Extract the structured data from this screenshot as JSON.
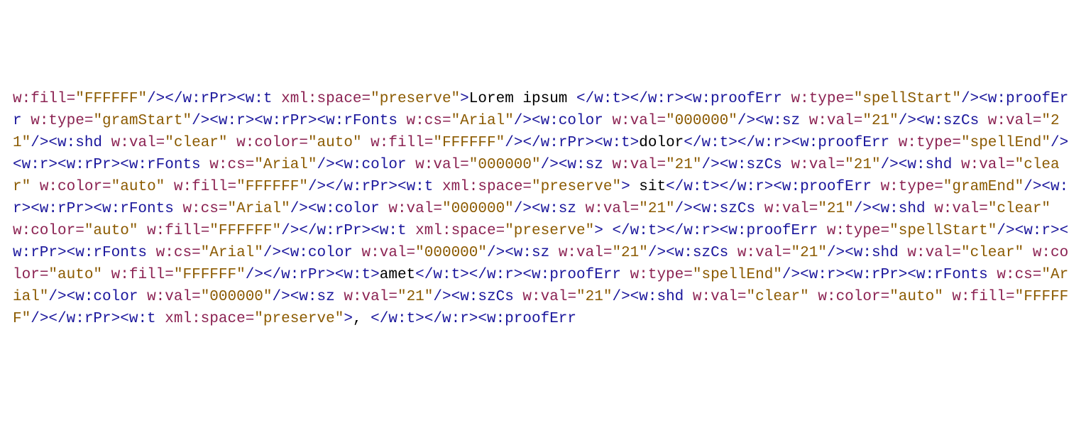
{
  "tokens": [
    {
      "t": "attrname",
      "v": "w:fill"
    },
    {
      "t": "punct",
      "v": "="
    },
    {
      "t": "attrval",
      "v": "\"FFFFFF\""
    },
    {
      "t": "tag",
      "v": "/></w:rPr><w:t"
    },
    {
      "t": "txt",
      "v": " "
    },
    {
      "t": "attrname",
      "v": "xml:space"
    },
    {
      "t": "punct",
      "v": "="
    },
    {
      "t": "attrval",
      "v": "\"preserve\""
    },
    {
      "t": "tag",
      "v": ">"
    },
    {
      "t": "txt",
      "v": "Lorem ipsum "
    },
    {
      "t": "tag",
      "v": "</w:t></w:r><w:proofErr"
    },
    {
      "t": "txt",
      "v": " "
    },
    {
      "t": "attrname",
      "v": "w:type"
    },
    {
      "t": "punct",
      "v": "="
    },
    {
      "t": "attrval",
      "v": "\"spellStart\""
    },
    {
      "t": "tag",
      "v": "/><w:proofErr"
    },
    {
      "t": "txt",
      "v": " "
    },
    {
      "t": "attrname",
      "v": "w:type"
    },
    {
      "t": "punct",
      "v": "="
    },
    {
      "t": "attrval",
      "v": "\"gramStart\""
    },
    {
      "t": "tag",
      "v": "/><w:r><w:rPr><w:rFonts"
    },
    {
      "t": "txt",
      "v": " "
    },
    {
      "t": "attrname",
      "v": "w:cs"
    },
    {
      "t": "punct",
      "v": "="
    },
    {
      "t": "attrval",
      "v": "\"Arial\""
    },
    {
      "t": "tag",
      "v": "/><w:color"
    },
    {
      "t": "txt",
      "v": " "
    },
    {
      "t": "attrname",
      "v": "w:val"
    },
    {
      "t": "punct",
      "v": "="
    },
    {
      "t": "attrval",
      "v": "\"000000\""
    },
    {
      "t": "tag",
      "v": "/><w:sz"
    },
    {
      "t": "txt",
      "v": " "
    },
    {
      "t": "attrname",
      "v": "w:val"
    },
    {
      "t": "punct",
      "v": "="
    },
    {
      "t": "attrval",
      "v": "\"21\""
    },
    {
      "t": "tag",
      "v": "/><w:szCs"
    },
    {
      "t": "txt",
      "v": " "
    },
    {
      "t": "attrname",
      "v": "w:val"
    },
    {
      "t": "punct",
      "v": "="
    },
    {
      "t": "attrval",
      "v": "\"21\""
    },
    {
      "t": "tag",
      "v": "/><w:shd"
    },
    {
      "t": "txt",
      "v": " "
    },
    {
      "t": "attrname",
      "v": "w:val"
    },
    {
      "t": "punct",
      "v": "="
    },
    {
      "t": "attrval",
      "v": "\"clear\""
    },
    {
      "t": "txt",
      "v": " "
    },
    {
      "t": "attrname",
      "v": "w:color"
    },
    {
      "t": "punct",
      "v": "="
    },
    {
      "t": "attrval",
      "v": "\"auto\""
    },
    {
      "t": "txt",
      "v": " "
    },
    {
      "t": "attrname",
      "v": "w:fill"
    },
    {
      "t": "punct",
      "v": "="
    },
    {
      "t": "attrval",
      "v": "\"FFFFFF\""
    },
    {
      "t": "tag",
      "v": "/></w:rPr><w:t>"
    },
    {
      "t": "txt",
      "v": "dolor"
    },
    {
      "t": "tag",
      "v": "</w:t></w:r><w:proofErr"
    },
    {
      "t": "txt",
      "v": " "
    },
    {
      "t": "attrname",
      "v": "w:type"
    },
    {
      "t": "punct",
      "v": "="
    },
    {
      "t": "attrval",
      "v": "\"spellEnd\""
    },
    {
      "t": "tag",
      "v": "/><w:r><w:rPr><w:rFonts"
    },
    {
      "t": "txt",
      "v": " "
    },
    {
      "t": "attrname",
      "v": "w:cs"
    },
    {
      "t": "punct",
      "v": "="
    },
    {
      "t": "attrval",
      "v": "\"Arial\""
    },
    {
      "t": "tag",
      "v": "/><w:color"
    },
    {
      "t": "txt",
      "v": " "
    },
    {
      "t": "attrname",
      "v": "w:val"
    },
    {
      "t": "punct",
      "v": "="
    },
    {
      "t": "attrval",
      "v": "\"000000\""
    },
    {
      "t": "tag",
      "v": "/><w:sz"
    },
    {
      "t": "txt",
      "v": " "
    },
    {
      "t": "attrname",
      "v": "w:val"
    },
    {
      "t": "punct",
      "v": "="
    },
    {
      "t": "attrval",
      "v": "\"21\""
    },
    {
      "t": "tag",
      "v": "/><w:szCs"
    },
    {
      "t": "txt",
      "v": " "
    },
    {
      "t": "attrname",
      "v": "w:val"
    },
    {
      "t": "punct",
      "v": "="
    },
    {
      "t": "attrval",
      "v": "\"21\""
    },
    {
      "t": "tag",
      "v": "/><w:shd"
    },
    {
      "t": "txt",
      "v": " "
    },
    {
      "t": "attrname",
      "v": "w:val"
    },
    {
      "t": "punct",
      "v": "="
    },
    {
      "t": "attrval",
      "v": "\"clear\""
    },
    {
      "t": "txt",
      "v": " "
    },
    {
      "t": "attrname",
      "v": "w:color"
    },
    {
      "t": "punct",
      "v": "="
    },
    {
      "t": "attrval",
      "v": "\"auto\""
    },
    {
      "t": "txt",
      "v": " "
    },
    {
      "t": "attrname",
      "v": "w:fill"
    },
    {
      "t": "punct",
      "v": "="
    },
    {
      "t": "attrval",
      "v": "\"FFFFFF\""
    },
    {
      "t": "tag",
      "v": "/></w:rPr><w:t"
    },
    {
      "t": "txt",
      "v": " "
    },
    {
      "t": "attrname",
      "v": "xml:space"
    },
    {
      "t": "punct",
      "v": "="
    },
    {
      "t": "attrval",
      "v": "\"preserve\""
    },
    {
      "t": "tag",
      "v": ">"
    },
    {
      "t": "txt",
      "v": " sit"
    },
    {
      "t": "tag",
      "v": "</w:t></w:r><w:proofErr"
    },
    {
      "t": "txt",
      "v": " "
    },
    {
      "t": "attrname",
      "v": "w:type"
    },
    {
      "t": "punct",
      "v": "="
    },
    {
      "t": "attrval",
      "v": "\"gramEnd\""
    },
    {
      "t": "tag",
      "v": "/><w:r><w:rPr><w:rFonts"
    },
    {
      "t": "txt",
      "v": " "
    },
    {
      "t": "attrname",
      "v": "w:cs"
    },
    {
      "t": "punct",
      "v": "="
    },
    {
      "t": "attrval",
      "v": "\"Arial\""
    },
    {
      "t": "tag",
      "v": "/><w:color"
    },
    {
      "t": "txt",
      "v": " "
    },
    {
      "t": "attrname",
      "v": "w:val"
    },
    {
      "t": "punct",
      "v": "="
    },
    {
      "t": "attrval",
      "v": "\"000000\""
    },
    {
      "t": "tag",
      "v": "/><w:sz"
    },
    {
      "t": "txt",
      "v": " "
    },
    {
      "t": "attrname",
      "v": "w:val"
    },
    {
      "t": "punct",
      "v": "="
    },
    {
      "t": "attrval",
      "v": "\"21\""
    },
    {
      "t": "tag",
      "v": "/><w:szCs"
    },
    {
      "t": "txt",
      "v": " "
    },
    {
      "t": "attrname",
      "v": "w:val"
    },
    {
      "t": "punct",
      "v": "="
    },
    {
      "t": "attrval",
      "v": "\"21\""
    },
    {
      "t": "tag",
      "v": "/><w:shd"
    },
    {
      "t": "txt",
      "v": " "
    },
    {
      "t": "attrname",
      "v": "w:val"
    },
    {
      "t": "punct",
      "v": "="
    },
    {
      "t": "attrval",
      "v": "\"clear\""
    },
    {
      "t": "txt",
      "v": " "
    },
    {
      "t": "attrname",
      "v": "w:color"
    },
    {
      "t": "punct",
      "v": "="
    },
    {
      "t": "attrval",
      "v": "\"auto\""
    },
    {
      "t": "txt",
      "v": " "
    },
    {
      "t": "attrname",
      "v": "w:fill"
    },
    {
      "t": "punct",
      "v": "="
    },
    {
      "t": "attrval",
      "v": "\"FFFFFF\""
    },
    {
      "t": "tag",
      "v": "/></w:rPr><w:t"
    },
    {
      "t": "txt",
      "v": " "
    },
    {
      "t": "attrname",
      "v": "xml:space"
    },
    {
      "t": "punct",
      "v": "="
    },
    {
      "t": "attrval",
      "v": "\"preserve\""
    },
    {
      "t": "tag",
      "v": ">"
    },
    {
      "t": "txt",
      "v": " "
    },
    {
      "t": "tag",
      "v": "</w:t></w:r><w:proofErr"
    },
    {
      "t": "txt",
      "v": " "
    },
    {
      "t": "attrname",
      "v": "w:type"
    },
    {
      "t": "punct",
      "v": "="
    },
    {
      "t": "attrval",
      "v": "\"spellStart\""
    },
    {
      "t": "tag",
      "v": "/><w:r><w:rPr><w:rFonts"
    },
    {
      "t": "txt",
      "v": " "
    },
    {
      "t": "attrname",
      "v": "w:cs"
    },
    {
      "t": "punct",
      "v": "="
    },
    {
      "t": "attrval",
      "v": "\"Arial\""
    },
    {
      "t": "tag",
      "v": "/><w:color"
    },
    {
      "t": "txt",
      "v": " "
    },
    {
      "t": "attrname",
      "v": "w:val"
    },
    {
      "t": "punct",
      "v": "="
    },
    {
      "t": "attrval",
      "v": "\"000000\""
    },
    {
      "t": "tag",
      "v": "/><w:sz"
    },
    {
      "t": "txt",
      "v": " "
    },
    {
      "t": "attrname",
      "v": "w:val"
    },
    {
      "t": "punct",
      "v": "="
    },
    {
      "t": "attrval",
      "v": "\"21\""
    },
    {
      "t": "tag",
      "v": "/><w:szCs"
    },
    {
      "t": "txt",
      "v": " "
    },
    {
      "t": "attrname",
      "v": "w:val"
    },
    {
      "t": "punct",
      "v": "="
    },
    {
      "t": "attrval",
      "v": "\"21\""
    },
    {
      "t": "tag",
      "v": "/><w:shd"
    },
    {
      "t": "txt",
      "v": " "
    },
    {
      "t": "attrname",
      "v": "w:val"
    },
    {
      "t": "punct",
      "v": "="
    },
    {
      "t": "attrval",
      "v": "\"clear\""
    },
    {
      "t": "txt",
      "v": " "
    },
    {
      "t": "attrname",
      "v": "w:color"
    },
    {
      "t": "punct",
      "v": "="
    },
    {
      "t": "attrval",
      "v": "\"auto\""
    },
    {
      "t": "txt",
      "v": " "
    },
    {
      "t": "attrname",
      "v": "w:fill"
    },
    {
      "t": "punct",
      "v": "="
    },
    {
      "t": "attrval",
      "v": "\"FFFFFF\""
    },
    {
      "t": "tag",
      "v": "/></w:rPr><w:t>"
    },
    {
      "t": "txt",
      "v": "amet"
    },
    {
      "t": "tag",
      "v": "</w:t></w:r><w:proofErr"
    },
    {
      "t": "txt",
      "v": " "
    },
    {
      "t": "attrname",
      "v": "w:type"
    },
    {
      "t": "punct",
      "v": "="
    },
    {
      "t": "attrval",
      "v": "\"spellEnd\""
    },
    {
      "t": "tag",
      "v": "/><w:r><w:rPr><w:rFonts"
    },
    {
      "t": "txt",
      "v": " "
    },
    {
      "t": "attrname",
      "v": "w:cs"
    },
    {
      "t": "punct",
      "v": "="
    },
    {
      "t": "attrval",
      "v": "\"Arial\""
    },
    {
      "t": "tag",
      "v": "/><w:color"
    },
    {
      "t": "txt",
      "v": " "
    },
    {
      "t": "attrname",
      "v": "w:val"
    },
    {
      "t": "punct",
      "v": "="
    },
    {
      "t": "attrval",
      "v": "\"000000\""
    },
    {
      "t": "tag",
      "v": "/><w:sz"
    },
    {
      "t": "txt",
      "v": " "
    },
    {
      "t": "attrname",
      "v": "w:val"
    },
    {
      "t": "punct",
      "v": "="
    },
    {
      "t": "attrval",
      "v": "\"21\""
    },
    {
      "t": "tag",
      "v": "/><w:szCs"
    },
    {
      "t": "txt",
      "v": " "
    },
    {
      "t": "attrname",
      "v": "w:val"
    },
    {
      "t": "punct",
      "v": "="
    },
    {
      "t": "attrval",
      "v": "\"21\""
    },
    {
      "t": "tag",
      "v": "/><w:shd"
    },
    {
      "t": "txt",
      "v": " "
    },
    {
      "t": "attrname",
      "v": "w:val"
    },
    {
      "t": "punct",
      "v": "="
    },
    {
      "t": "attrval",
      "v": "\"clear\""
    },
    {
      "t": "txt",
      "v": " "
    },
    {
      "t": "attrname",
      "v": "w:color"
    },
    {
      "t": "punct",
      "v": "="
    },
    {
      "t": "attrval",
      "v": "\"auto\""
    },
    {
      "t": "txt",
      "v": " "
    },
    {
      "t": "attrname",
      "v": "w:fill"
    },
    {
      "t": "punct",
      "v": "="
    },
    {
      "t": "attrval",
      "v": "\"FFFFFF\""
    },
    {
      "t": "tag",
      "v": "/></w:rPr><w:t"
    },
    {
      "t": "txt",
      "v": " "
    },
    {
      "t": "attrname",
      "v": "xml:space"
    },
    {
      "t": "punct",
      "v": "="
    },
    {
      "t": "attrval",
      "v": "\"preserve\""
    },
    {
      "t": "tag",
      "v": ">"
    },
    {
      "t": "txt",
      "v": ", "
    },
    {
      "t": "tag",
      "v": "</w:t></w:r><w:proofErr"
    },
    {
      "t": "txt",
      "v": " "
    }
  ]
}
